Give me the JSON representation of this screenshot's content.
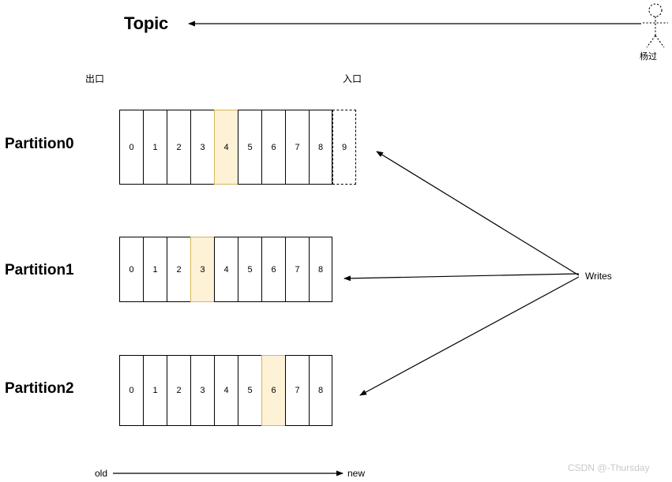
{
  "diagram": {
    "title": "Topic",
    "actor": {
      "name": "杨过",
      "icon": "stick-figure-icon"
    },
    "ports": {
      "exit": "出口",
      "entrance": "入口"
    },
    "writes_label": "Writes",
    "axis": {
      "left": "old",
      "right": "new"
    },
    "watermark": "CSDN @-Thursday",
    "colors": {
      "highlight_fill": "#fdf1d6",
      "highlight_border": "#d6b656",
      "stroke": "#000000",
      "watermark": "#c9c9c9"
    },
    "partitions": [
      {
        "label": "Partition0",
        "cells": [
          {
            "value": "0",
            "state": "normal"
          },
          {
            "value": "1",
            "state": "normal"
          },
          {
            "value": "2",
            "state": "normal"
          },
          {
            "value": "3",
            "state": "normal"
          },
          {
            "value": "4",
            "state": "highlight"
          },
          {
            "value": "5",
            "state": "normal"
          },
          {
            "value": "6",
            "state": "normal"
          },
          {
            "value": "7",
            "state": "normal"
          },
          {
            "value": "8",
            "state": "normal"
          },
          {
            "value": "9",
            "state": "dashed"
          }
        ]
      },
      {
        "label": "Partition1",
        "cells": [
          {
            "value": "0",
            "state": "normal"
          },
          {
            "value": "1",
            "state": "normal"
          },
          {
            "value": "2",
            "state": "normal"
          },
          {
            "value": "3",
            "state": "highlight"
          },
          {
            "value": "4",
            "state": "normal"
          },
          {
            "value": "5",
            "state": "normal"
          },
          {
            "value": "6",
            "state": "normal"
          },
          {
            "value": "7",
            "state": "normal"
          },
          {
            "value": "8",
            "state": "normal"
          }
        ]
      },
      {
        "label": "Partition2",
        "cells": [
          {
            "value": "0",
            "state": "normal"
          },
          {
            "value": "1",
            "state": "normal"
          },
          {
            "value": "2",
            "state": "normal"
          },
          {
            "value": "3",
            "state": "normal"
          },
          {
            "value": "4",
            "state": "normal"
          },
          {
            "value": "5",
            "state": "normal"
          },
          {
            "value": "6",
            "state": "highlight"
          },
          {
            "value": "7",
            "state": "normal"
          },
          {
            "value": "8",
            "state": "normal"
          }
        ]
      }
    ]
  }
}
